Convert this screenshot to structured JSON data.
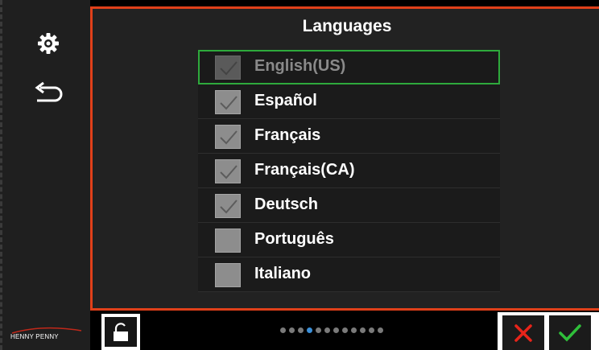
{
  "sidebar": {
    "settings_icon": "gear-icon",
    "back_icon": "back-arrow-icon",
    "logo_text": "HENNY PENNY"
  },
  "panel": {
    "title": "Languages",
    "languages": [
      {
        "label": "English(US)",
        "checked": true,
        "disabled": true,
        "selected": true
      },
      {
        "label": "Español",
        "checked": true,
        "disabled": false,
        "selected": false
      },
      {
        "label": "Français",
        "checked": true,
        "disabled": false,
        "selected": false
      },
      {
        "label": "Français(CA)",
        "checked": true,
        "disabled": false,
        "selected": false
      },
      {
        "label": "Deutsch",
        "checked": true,
        "disabled": false,
        "selected": false
      },
      {
        "label": "Português",
        "checked": false,
        "disabled": false,
        "selected": false
      },
      {
        "label": "Italiano",
        "checked": false,
        "disabled": false,
        "selected": false
      }
    ]
  },
  "footer": {
    "lock_icon": "unlock-icon",
    "page_count": 12,
    "current_page": 4,
    "cancel_icon": "close-icon",
    "confirm_icon": "checkmark-icon"
  },
  "colors": {
    "accent_border": "#e0401a",
    "selected_outline": "#2eaa3c",
    "active_dot": "#3b8fd8",
    "cancel": "#e8241a",
    "confirm": "#2fbf3a"
  }
}
